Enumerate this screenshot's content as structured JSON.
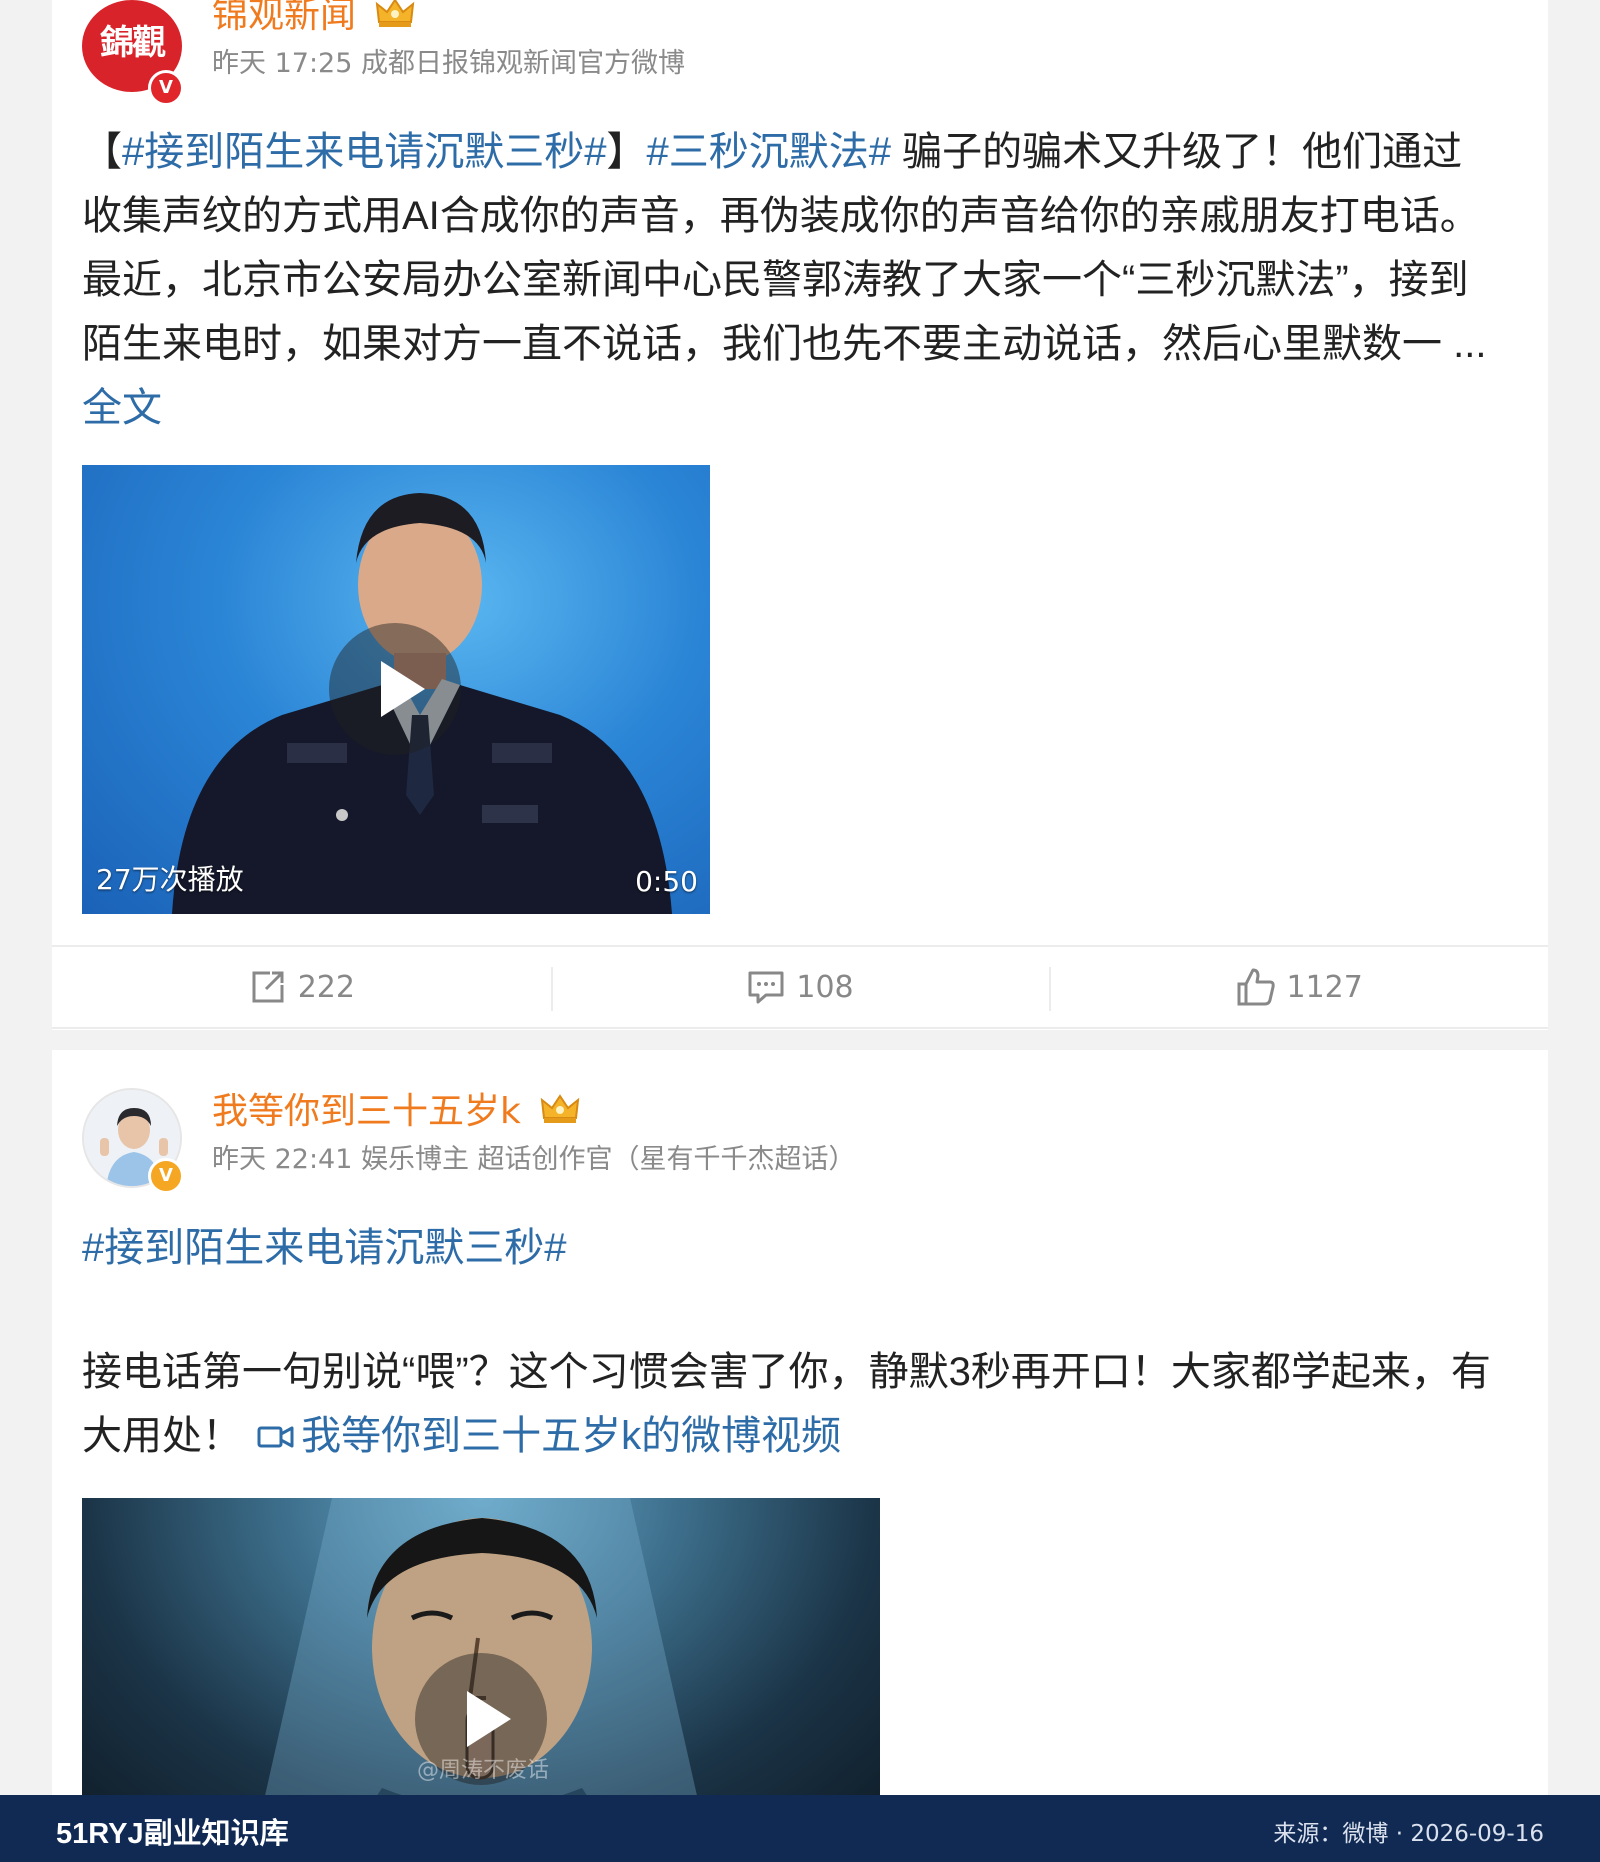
{
  "posts": [
    {
      "username": "锦观新闻",
      "avatar_text": "錦觀",
      "meta": "昨天 17:25 成都日报锦观新闻官方微博",
      "body": {
        "bracket_open": "【",
        "hashtag1": "#接到陌生来电请沉默三秒#",
        "bracket_close": "】",
        "hashtag2": "#三秒沉默法#",
        "text": " 骗子的骗术又升级了！他们通过收集声纹的方式用AI合成你的声音，再伪装成你的声音给你的亲戚朋友打电话。最近，北京市公安局办公室新闻中心民警郭涛教了大家一个“三秒沉默法”，接到陌生来电时，如果对方一直不说话，我们也先不要主动说话，然后心里默数一 ...",
        "more_link": "全文"
      },
      "video": {
        "play_count": "27万次播放",
        "duration": "0:50"
      },
      "actions": {
        "repost": "222",
        "comment": "108",
        "like": "1127"
      }
    },
    {
      "username": "我等你到三十五岁k",
      "meta": "昨天 22:41 娱乐博主 超话创作官（星有千千杰超话）",
      "body": {
        "hashtag": "#接到陌生来电请沉默三秒#",
        "text": "接电话第一句别说“喂”？这个习惯会害了你，静默3秒再开口！大家都学起来，有大用处！ ",
        "video_link": "我等你到三十五岁k的微博视频"
      },
      "video": {
        "watermark": "@周涛不废话"
      }
    }
  ],
  "footer": {
    "brand": "51RYJ副业知识库",
    "source": "来源：微博 · 2026-09-16"
  },
  "colors": {
    "username": "#f07b1f",
    "link": "#2e6ca8",
    "footer_bg": "#102a54"
  }
}
